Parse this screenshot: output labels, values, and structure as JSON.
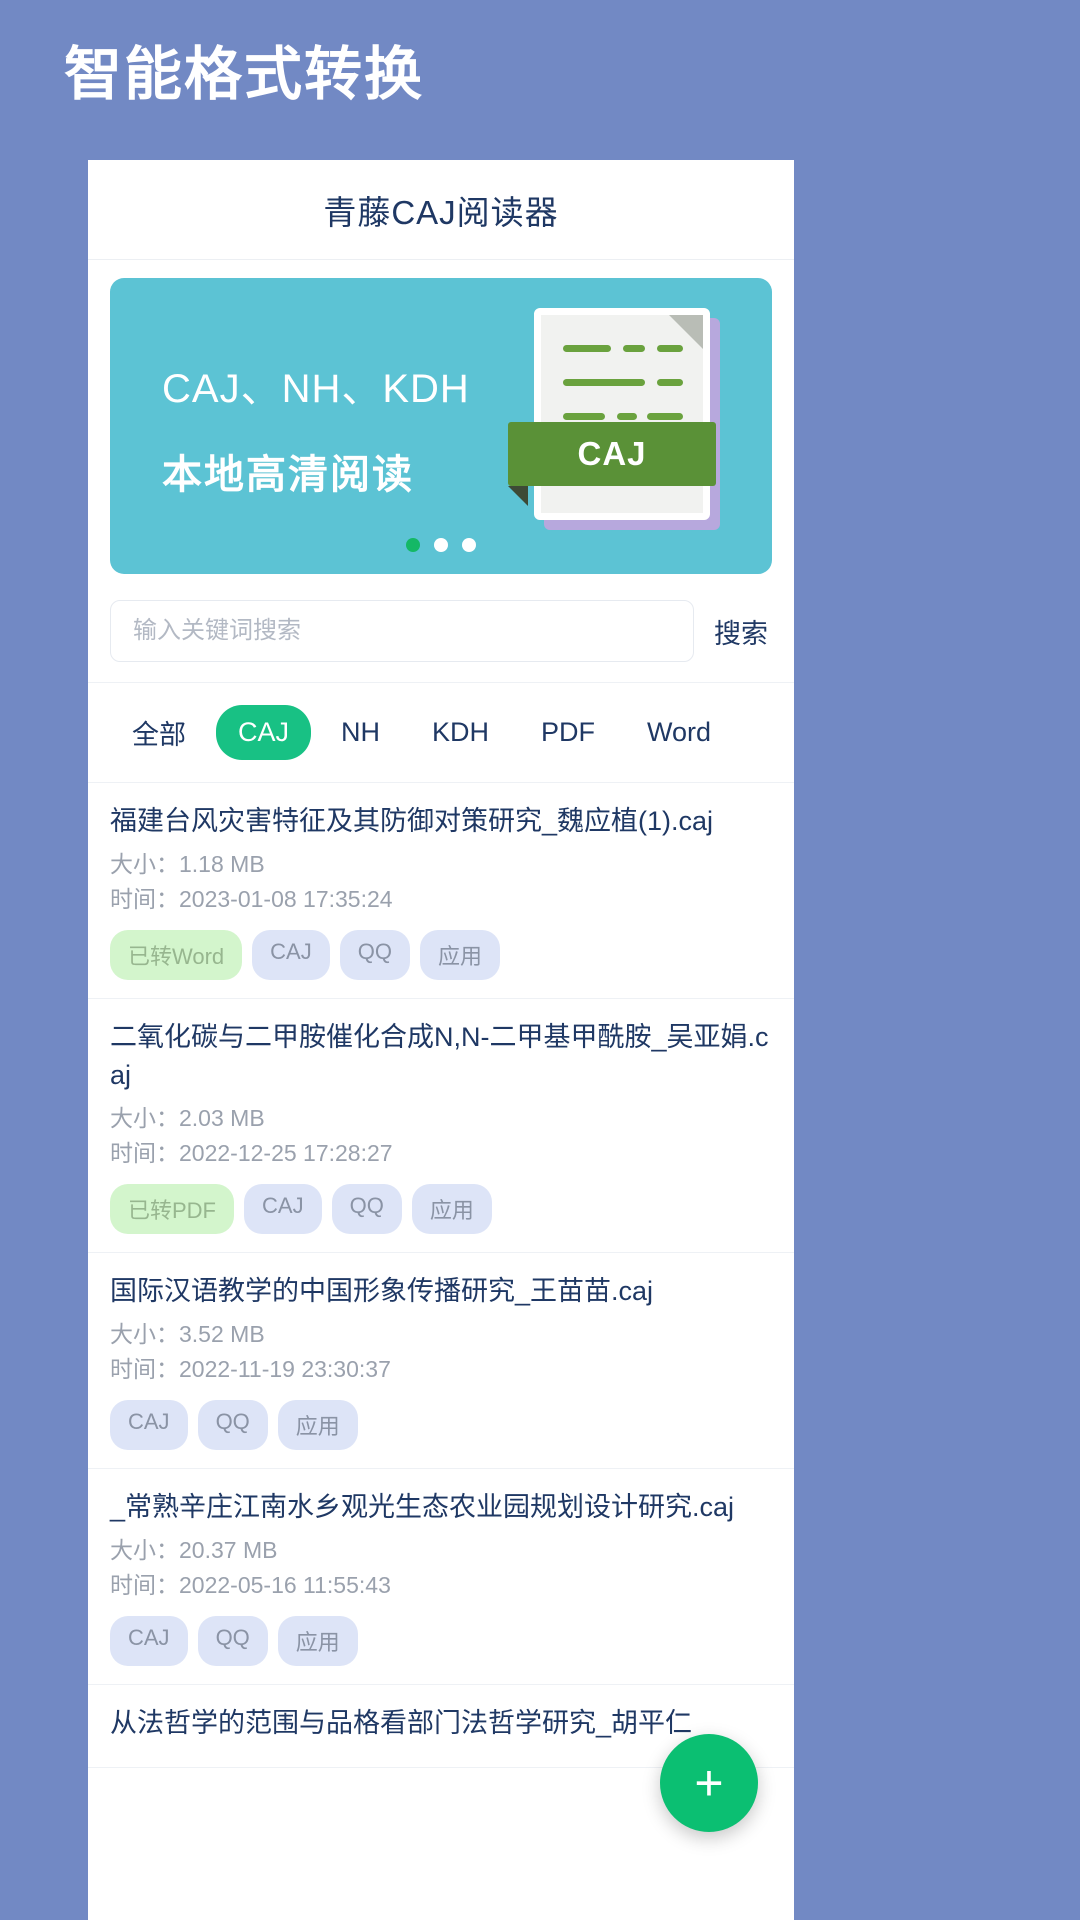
{
  "page": {
    "title": "智能格式转换",
    "bg_color": "#7289c4"
  },
  "app": {
    "title": "青藤CAJ阅读器"
  },
  "banner": {
    "line1": "CAJ、NH、KDH",
    "line2": "本地高清阅读",
    "badge_label": "CAJ",
    "bg_color": "#5cc3d4",
    "active_dot_color": "#14b866",
    "dots": 3,
    "active_dot_index": 0
  },
  "search": {
    "placeholder": "输入关键词搜索",
    "value": "",
    "button_label": "搜索"
  },
  "filters": {
    "items": [
      {
        "label": "全部",
        "active": false
      },
      {
        "label": "CAJ",
        "active": true
      },
      {
        "label": "NH",
        "active": false
      },
      {
        "label": "KDH",
        "active": false
      },
      {
        "label": "PDF",
        "active": false
      },
      {
        "label": "Word",
        "active": false
      }
    ],
    "active_color": "#18c184"
  },
  "labels": {
    "size_label": "大小：",
    "time_label": "时间："
  },
  "files": [
    {
      "name": "福建台风灾害特征及其防御对策研究_魏应植(1).caj",
      "size": "大小：1.18 MB",
      "time": "时间：2023-01-08 17:35:24",
      "tags": [
        {
          "label": "已转Word",
          "converted": true
        },
        {
          "label": "CAJ",
          "converted": false
        },
        {
          "label": "QQ",
          "converted": false
        },
        {
          "label": "应用",
          "converted": false
        }
      ]
    },
    {
      "name": "二氧化碳与二甲胺催化合成N,N-二甲基甲酰胺_吴亚娟.caj",
      "size": "大小：2.03 MB",
      "time": "时间：2022-12-25 17:28:27",
      "tags": [
        {
          "label": "已转PDF",
          "converted": true
        },
        {
          "label": "CAJ",
          "converted": false
        },
        {
          "label": "QQ",
          "converted": false
        },
        {
          "label": "应用",
          "converted": false
        }
      ]
    },
    {
      "name": "国际汉语教学的中国形象传播研究_王苗苗.caj",
      "size": "大小：3.52 MB",
      "time": "时间：2022-11-19 23:30:37",
      "tags": [
        {
          "label": "CAJ",
          "converted": false
        },
        {
          "label": "QQ",
          "converted": false
        },
        {
          "label": "应用",
          "converted": false
        }
      ]
    },
    {
      "name": "_常熟辛庄江南水乡观光生态农业园规划设计研究.caj",
      "size": "大小：20.37 MB",
      "time": "时间：2022-05-16 11:55:43",
      "tags": [
        {
          "label": "CAJ",
          "converted": false
        },
        {
          "label": "QQ",
          "converted": false
        },
        {
          "label": "应用",
          "converted": false
        }
      ]
    },
    {
      "name": "从法哲学的范围与品格看部门法哲学研究_胡平仁",
      "size": "",
      "time": "",
      "tags": []
    }
  ],
  "fab": {
    "label": "+",
    "color": "#0bbf72"
  }
}
